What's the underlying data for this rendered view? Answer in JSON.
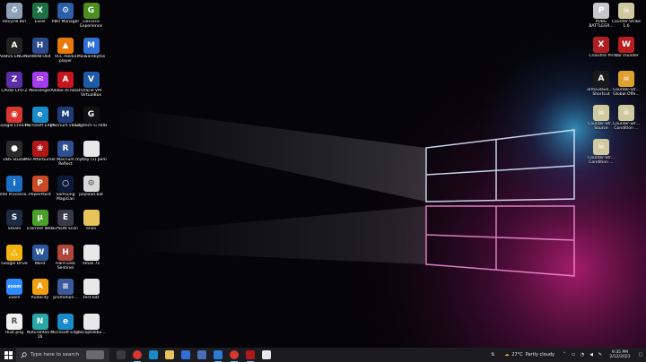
{
  "desktop": {
    "left_icons": [
      {
        "label": "Recycle Bin",
        "icon": "recycle-bin-icon",
        "color": "#8da2b8",
        "glyph": "♻"
      },
      {
        "label": "Excel",
        "icon": "excel-icon",
        "color": "#1d7044",
        "glyph": "X"
      },
      {
        "label": "PBO Manager",
        "icon": "gear-icon",
        "color": "#2b5fa8",
        "glyph": "⚙"
      },
      {
        "label": "GeForce Experience",
        "icon": "geforce-icon",
        "color": "#4a8f1e",
        "glyph": "G"
      },
      {
        "label": "AOBUS ENGINE",
        "icon": "aorus-icon",
        "color": "#222222",
        "glyph": "A"
      },
      {
        "label": "HWiNFO64",
        "icon": "hwinfo-icon",
        "color": "#2a4a8a",
        "glyph": "H"
      },
      {
        "label": "VLC media player",
        "icon": "vlc-icon",
        "color": "#e87a0c",
        "glyph": "▲"
      },
      {
        "label": "Malwarebytes",
        "icon": "malwarebytes-icon",
        "color": "#2f6fd6",
        "glyph": "M"
      },
      {
        "label": "CPUID CPU-Z",
        "icon": "cpuz-icon",
        "color": "#5a2ea6",
        "glyph": "Z"
      },
      {
        "label": "Messenger",
        "icon": "messenger-icon",
        "color": "#a33cf0",
        "glyph": "✉"
      },
      {
        "label": "Adobe Acrobat",
        "icon": "acrobat-icon",
        "color": "#c4161c",
        "glyph": "A"
      },
      {
        "label": "Oracle VM VirtualBox",
        "icon": "virtualbox-icon",
        "color": "#1f5aa8",
        "glyph": "V"
      },
      {
        "label": "Google Chrome",
        "icon": "chrome-icon",
        "color": "#d9362e",
        "glyph": "◉"
      },
      {
        "label": "Microsoft Edge",
        "icon": "edge-icon",
        "color": "#1b8ac9",
        "glyph": "e"
      },
      {
        "label": "Macrium vBoot",
        "icon": "macrium-icon",
        "color": "#1d3c7a",
        "glyph": "M"
      },
      {
        "label": "Logitech G HUB",
        "icon": "logitech-icon",
        "color": "#111111",
        "glyph": "G"
      },
      {
        "label": "OBS Studio",
        "icon": "obs-icon",
        "color": "#2b2b2b",
        "glyph": "●"
      },
      {
        "label": "MSI Afterburner",
        "icon": "afterburner-icon",
        "color": "#b01818",
        "glyph": "❀"
      },
      {
        "label": "Macrium Reflect",
        "icon": "macrium-reflect-icon",
        "color": "#2f4f8f",
        "glyph": "R"
      },
      {
        "label": "myKey (1).pem",
        "icon": "file-icon",
        "color": "#e8e8e8",
        "glyph": ""
      },
      {
        "label": "Intel Processo...",
        "icon": "intel-icon",
        "color": "#1a6fc4",
        "glyph": "i"
      },
      {
        "label": "PowerPoint",
        "icon": "powerpoint-icon",
        "color": "#c84a24",
        "glyph": "P"
      },
      {
        "label": "Samsung Magician",
        "icon": "samsung-icon",
        "color": "#0b1a3a",
        "glyph": "○"
      },
      {
        "label": "payload.bat",
        "icon": "batch-file-icon",
        "color": "#d8d8d8",
        "glyph": "⚙"
      },
      {
        "label": "Steam",
        "icon": "steam-icon",
        "color": "#1b2b44",
        "glyph": "S"
      },
      {
        "label": "uTorrent Web",
        "icon": "utorrent-icon",
        "color": "#4aa02a",
        "glyph": "µ"
      },
      {
        "label": "EPSON Scan",
        "icon": "epson-icon",
        "color": "#3a3a4a",
        "glyph": "E"
      },
      {
        "label": "enzo",
        "icon": "folder-icon",
        "color": "#e8c35a",
        "glyph": ""
      },
      {
        "label": "Google Drive",
        "icon": "google-drive-icon",
        "color": "#f2b50f",
        "glyph": "△"
      },
      {
        "label": "Word",
        "icon": "word-icon",
        "color": "#2b579a",
        "glyph": "W"
      },
      {
        "label": "Hard Disk Sentinel",
        "icon": "hdsentinel-icon",
        "color": "#b0453a",
        "glyph": "H"
      },
      {
        "label": "email.7z",
        "icon": "archive-file-icon",
        "color": "#e8e8e8",
        "glyph": ""
      },
      {
        "label": "Zoom",
        "icon": "zoom-icon",
        "color": "#2d8cff",
        "glyph": "zoom"
      },
      {
        "label": "Audacity",
        "icon": "audacity-icon",
        "color": "#f0a010",
        "glyph": "A"
      },
      {
        "label": "promotion...",
        "icon": "document-icon",
        "color": "#3a5a9a",
        "glyph": "≡"
      },
      {
        "label": "test.bat",
        "icon": "batch-file-icon",
        "color": "#e8e8e8",
        "glyph": ""
      },
      {
        "label": "Rust.png",
        "icon": "image-file-icon",
        "color": "#f0f0f0",
        "glyph": "R"
      },
      {
        "label": "NaturalRea... 16",
        "icon": "naturalreader-icon",
        "color": "#2aa6a6",
        "glyph": "N"
      },
      {
        "label": "Microsoft Edge",
        "icon": "edge-icon",
        "color": "#1b8ac9",
        "glyph": "e"
      },
      {
        "label": "mscoptdebu...",
        "icon": "text-file-icon",
        "color": "#e8e8e8",
        "glyph": ""
      }
    ],
    "right_icons": [
      {
        "label": "PUBG BATTLEGR...",
        "icon": "pubg-icon",
        "color": "#c8c8c8",
        "glyph": "P"
      },
      {
        "label": "Counter-Strike 1.6",
        "icon": "counter-strike-icon",
        "color": "#d0c9a0",
        "glyph": "☠"
      },
      {
        "label": "Crossfire PH",
        "icon": "crossfire-icon",
        "color": "#b02020",
        "glyph": "X"
      },
      {
        "label": "WarThunder",
        "icon": "warthunder-icon",
        "color": "#b81c1c",
        "glyph": "W"
      },
      {
        "label": "arma3laun... - Shortcut",
        "icon": "arma3-icon",
        "color": "#1a1a1a",
        "glyph": "A"
      },
      {
        "label": "Counter-Str... Global Offe...",
        "icon": "csgo-icon",
        "color": "#e0a030",
        "glyph": "☠"
      },
      {
        "label": "Counter-Str... Source",
        "icon": "css-icon",
        "color": "#d0c9a0",
        "glyph": "☠"
      },
      {
        "label": "Counter-Str... Condition ...",
        "icon": "cscz-icon",
        "color": "#d0c9a0",
        "glyph": "☠"
      },
      {
        "label": "Counter-Str... Condition ...",
        "icon": "cscz-icon",
        "color": "#d0c9a0",
        "glyph": "☠"
      }
    ]
  },
  "taskbar": {
    "start_icon": "windows-start-icon",
    "search_placeholder": "Type here to search",
    "apps": [
      {
        "name": "task-view-icon",
        "color": "#3a3a3a",
        "active": false
      },
      {
        "name": "chrome-icon",
        "color": "#d9362e",
        "active": true
      },
      {
        "name": "edge-icon",
        "color": "#1b8ac9",
        "active": false
      },
      {
        "name": "file-explorer-icon",
        "color": "#e8c35a",
        "active": false
      },
      {
        "name": "mail-icon",
        "color": "#2f6fd6",
        "active": false
      },
      {
        "name": "microsoft-store-icon",
        "color": "#4a6fb8",
        "active": false
      },
      {
        "name": "vscode-icon",
        "color": "#2a7ad8",
        "active": true
      },
      {
        "name": "chrome-icon",
        "color": "#d9362e",
        "active": true
      },
      {
        "name": "snipping-tool-icon",
        "color": "#b01818",
        "active": true
      },
      {
        "name": "shield-icon",
        "color": "#e8e8e8",
        "active": false
      }
    ],
    "weather": {
      "temp": "27°C",
      "condition": "Partly cloudy"
    },
    "clock": {
      "time": "9:35 PM",
      "date": "2/12/2023"
    }
  }
}
